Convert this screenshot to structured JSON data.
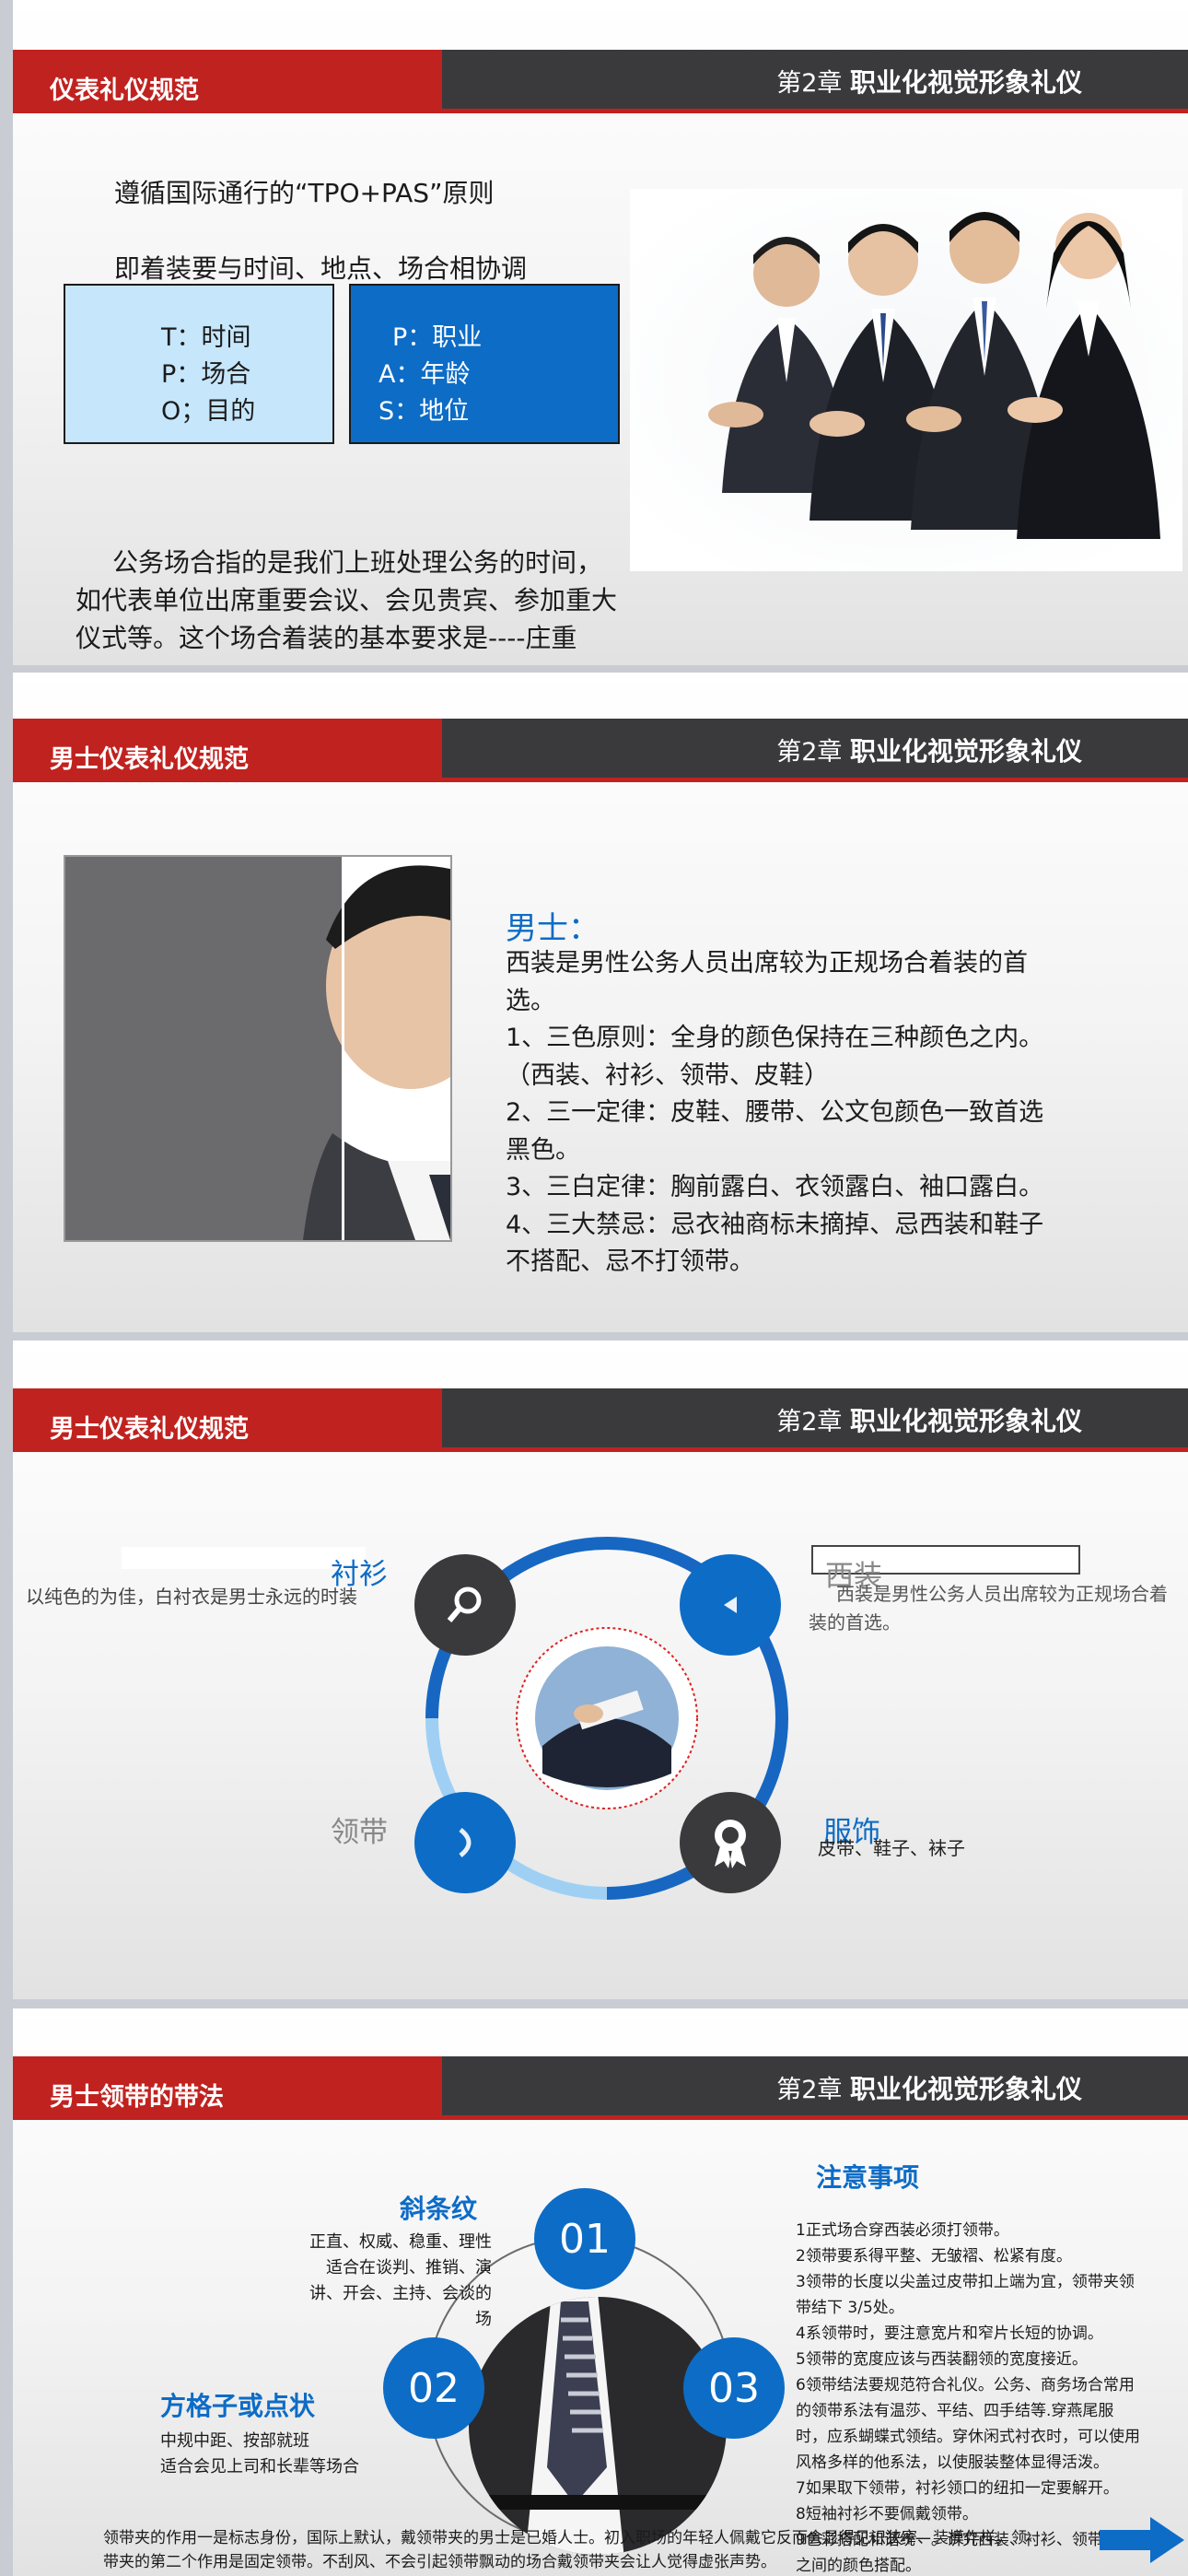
{
  "chapter": {
    "prefix": "第2章",
    "title": "职业化视觉形象礼仪"
  },
  "slide1": {
    "title": "仪表礼仪规范",
    "line1": "遵循国际通行的“TPO+PAS”原则",
    "line2": "即着装要与时间、地点、场合相协调",
    "box_left": [
      "T：时间",
      "P：场合",
      "O；目的"
    ],
    "box_right": [
      "P：职业",
      "A：年龄",
      "S：地位"
    ],
    "para": [
      "公务场合指的是我们上班处理公务的时间，",
      "如代表单位出席重要会议、会见贵宾、参加重大",
      "仪式等。这个场合着装的基本要求是----庄重"
    ]
  },
  "slide2": {
    "title": "男士仪表礼仪规范",
    "heading": "男士：",
    "lines": [
      "西装是男性公务人员出席较为正规场合着装的首",
      "选。",
      "1、三色原则：全身的颜色保持在三种颜色之内。",
      "（西装、衬衫、领带、皮鞋）",
      "2、三一定律：皮鞋、腰带、公文包颜色一致首选",
      "黑色。",
      "3、三白定律：胸前露白、衣领露白、袖口露白。",
      "4、三大禁忌：忌衣袖商标未摘掉、忌西装和鞋子",
      "不搭配、忌不打领带。"
    ]
  },
  "slide3": {
    "title": "男士仪表礼仪规范",
    "shirt_label": "衬衫",
    "shirt_desc": "以纯色的为佳，白衬衣是男士永远的时装",
    "suit_label": "西装",
    "suit_desc": [
      "西装是男性公务人员出席较为正规场合着",
      "装的首选。"
    ],
    "tie_label": "领带",
    "acc_label": "服饰",
    "acc_desc": "皮带、鞋子、袜子"
  },
  "slide4": {
    "title": "男士领带的带法",
    "diag_title": "斜条纹",
    "diag_desc": [
      "正直、权威、稳重、理性",
      "适合在谈判、推销、演",
      "讲、开会、主持、会谈的",
      "场"
    ],
    "grid_title": "方格子或点状",
    "grid_desc": [
      "中规中距、按部就班",
      "适合会见上司和长辈等场合"
    ],
    "num1": "01",
    "num2": "02",
    "num3": "03",
    "notes_title": "注意事项",
    "notes": [
      "1正式场合穿西装必须打领带。",
      "2领带要系得平整、无皱褶、松紧有度。",
      "3领带的长度以尖盖过皮带扣上端为宜，领带夹领",
      "带结下 3/5处。",
      "4系领带时，要注意宽片和窄片长短的协调。",
      "5领带的宽度应该与西装翻领的宽度接近。",
      "6领带结法要规范符合礼仪。公务、商务场合常用",
      "的领带系法有温莎、平结、四手结等.穿燕尾服",
      "时，应系蝴蝶式领结。穿休闲式衬衣时，可以使用",
      "风格多样的他系法，以使服装整体显得活泼。",
      "7如果取下领带，衬衫领口的纽扣一定要解开。",
      "8短袖衬衫不要佩戴领带。",
      "9色彩搭配和谐统一。讲究西装、衬衫、领带三者",
      "之间的颜色搭配。"
    ],
    "footer": [
      "领带夹的作用一是标志身份，国际上默认，戴领带夹的男士是已婚人士。初入职场的年轻人佩戴它反而会显得见识狭窄、装模作样。领",
      "带夹的第二个作用是固定领带。不刮风、不会引起领带飘动的场合戴领带夹会让人觉得虚张声势。"
    ]
  },
  "colors": {
    "red": "#c0221f",
    "dark": "#3a3a3c",
    "blue": "#0d6cc6",
    "lightblue": "#c6e6fb"
  }
}
